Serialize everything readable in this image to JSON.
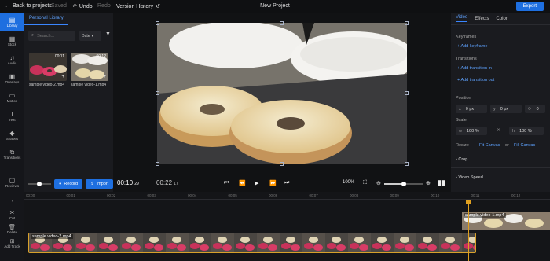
{
  "topbar": {
    "back_label": "Back to projects",
    "saved_label": "Saved",
    "undo_label": "Undo",
    "redo_label": "Redo",
    "version_history_label": "Version History",
    "project_title": "New Project",
    "export_label": "Export"
  },
  "nav": {
    "items": [
      {
        "label": "Library",
        "icon": "library-icon"
      },
      {
        "label": "Stock",
        "icon": "stock-icon"
      },
      {
        "label": "Audio",
        "icon": "music-note-icon"
      },
      {
        "label": "Overlays",
        "icon": "overlays-icon"
      },
      {
        "label": "Motion",
        "icon": "motion-icon"
      },
      {
        "label": "Text",
        "icon": "text-icon"
      },
      {
        "label": "Shapes",
        "icon": "shapes-icon"
      },
      {
        "label": "Transitions",
        "icon": "transitions-icon"
      }
    ],
    "reviews_label": "Reviews"
  },
  "library": {
    "tab_label": "Personal Library",
    "search_placeholder": "Search...",
    "sort_value": "Date",
    "thumbnails": [
      {
        "name": "sample video-2.mp4",
        "duration": "00:11"
      },
      {
        "name": "sample video-1.mp4",
        "duration": "00:12"
      }
    ],
    "record_label": "Record",
    "import_label": "Import"
  },
  "player": {
    "current_time": "00:10",
    "current_frames": "29",
    "duration_time": "00:22",
    "duration_frames": "17",
    "zoom_value": "100%",
    "zoom_level": 0.5
  },
  "right_panel": {
    "tabs": [
      "Video",
      "Effects",
      "Color"
    ],
    "keyframes_title": "Keyframes",
    "add_keyframe_label": "Add keyframe",
    "transitions_title": "Transitions",
    "add_transition_in_label": "Add transition in",
    "add_transition_out_label": "Add transition out",
    "position_title": "Position",
    "pos_x_label": "x",
    "pos_x_value": "0 px",
    "pos_y_label": "y",
    "pos_y_value": "0 px",
    "rotation_value": "0",
    "scale_title": "Scale",
    "scale_w_label": "w",
    "scale_w_value": "100 %",
    "scale_h_label": "h",
    "scale_h_value": "100 %",
    "resize_title": "Resize",
    "fit_canvas_label": "Fit Canvas",
    "or_label": "or",
    "fill_canvas_label": "Fill Canvas",
    "crop_label": "Crop",
    "video_speed_label": "Video Speed"
  },
  "timeline": {
    "tools": [
      {
        "label": "Cut",
        "icon": "scissors-icon"
      },
      {
        "label": "Delete",
        "icon": "trash-icon"
      },
      {
        "label": "Add Track",
        "icon": "add-track-icon"
      }
    ],
    "ruler": [
      "00:00",
      "00:01",
      "00:02",
      "00:03",
      "00:04",
      "00:05",
      "00:06",
      "00:07",
      "00:08",
      "00:09",
      "00:10",
      "00:11",
      "00:12"
    ],
    "clip_upper_name": "sample video-1.mp4",
    "clip_lower_name": "sample video-2.mp4"
  },
  "colors": {
    "accent": "#1e6fe0",
    "playhead": "#e0a020",
    "clip_border": "#d8a12b"
  }
}
